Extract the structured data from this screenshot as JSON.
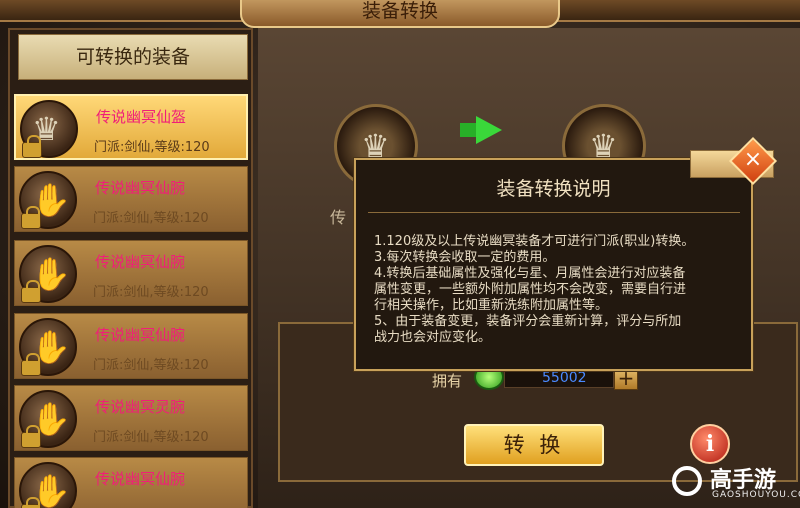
{
  "window": {
    "title": "装备转换"
  },
  "left_panel": {
    "header": "可转换的装备",
    "items": [
      {
        "name": "传说幽冥仙盔",
        "desc": "门派:剑仙,等级:120",
        "icon": "helmet-icon"
      },
      {
        "name": "传说幽冥仙腕",
        "desc": "门派:剑仙,等级:120",
        "icon": "gauntlet-icon"
      },
      {
        "name": "传说幽冥仙腕",
        "desc": "门派:剑仙,等级:120",
        "icon": "gauntlet-icon"
      },
      {
        "name": "传说幽冥仙腕",
        "desc": "门派:剑仙,等级:120",
        "icon": "gauntlet-icon"
      },
      {
        "name": "传说幽冥灵腕",
        "desc": "门派:剑仙,等级:120",
        "icon": "gauntlet-icon"
      },
      {
        "name": "传说幽冥仙腕",
        "desc": "",
        "icon": "gauntlet-icon"
      }
    ]
  },
  "main": {
    "bg_text": "传",
    "own_label": "拥有",
    "amount": "55002",
    "plus": "+",
    "convert_button": "转 换",
    "info_button": "i"
  },
  "modal": {
    "title": "装备转换说明",
    "lines": [
      "1.120级及以上传说幽冥装备才可进行门派(职业)转换。",
      "3.每次转换会收取一定的费用。",
      "4.转换后基础属性及强化与星、月属性会进行对应装备",
      "属性变更，一些额外附加属性均不会改变，需要自行进",
      "行相关操作，比如重新洗练附加属性等。",
      "5、由于装备变更，装备评分会重新计算，评分与所加",
      "战力也会对应变化。"
    ],
    "close": "×"
  },
  "watermark": {
    "text": "高手游",
    "sub": "GAOSHOUYOU.COM"
  },
  "colors": {
    "item_name": "#f01e78",
    "amount": "#4a8aff",
    "accent_gold": "#e0a020"
  }
}
